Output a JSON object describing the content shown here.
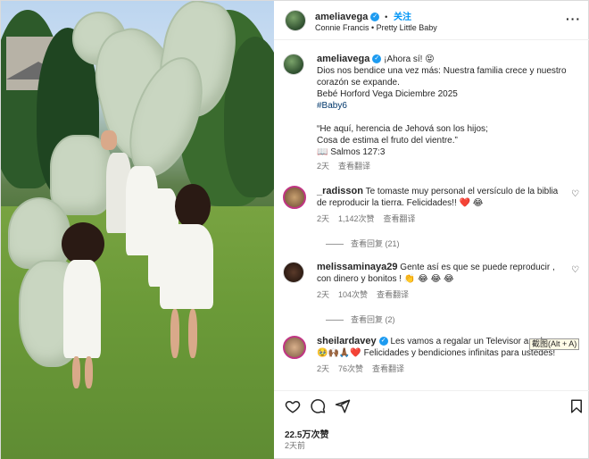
{
  "post": {
    "author": "ameliavega",
    "follow_label": "关注",
    "audio": "Connie Francis • Pretty Little Baby",
    "more_label": "···"
  },
  "caption": {
    "author": "ameliavega",
    "line1": "¡Ahora sí! 😝",
    "line2": "Dios nos bendice una vez más: Nuestra familia crece y nuestro corazón se expande.",
    "line3": "Bebé Horford Vega Diciembre 2025",
    "hashtag": "#Baby6",
    "quote1": "“He aquí, herencia de Jehová son los hijos;",
    "quote2": "Cosa de estima el fruto del vientre.”",
    "quote3": "📖 Salmos 127:3",
    "time": "2天",
    "translate": "查看翻译"
  },
  "comments": [
    {
      "user": "_radisson",
      "text": "Te tomaste muy personal el versículo de la biblia de reproducir la tierra. Felicidades!! ❤️ 😂",
      "time": "2天",
      "likes": "1,142次赞",
      "translate": "查看翻译",
      "replies": "查看回复 (21)"
    },
    {
      "user": "melissaminaya29",
      "text": "Gente así es que se puede reproducir , con dinero y bonitos ! 👏 😂 😂 😂",
      "time": "2天",
      "likes": "104次赞",
      "translate": "查看翻译",
      "replies": "查看回复 (2)"
    },
    {
      "user": "sheilardavey",
      "text": "Les vamos a regalar un Televisor a colo… 🥹🙌🏾🙏🏾❤️ Felicidades y bendiciones infinitas para ustedes!",
      "time": "2天",
      "likes": "76次赞",
      "translate": "查看翻译"
    }
  ],
  "tooltip": "截图(Alt + A)",
  "footer": {
    "likes": "22.5万次赞",
    "posted": "2天前"
  },
  "colors": {
    "link": "#00376b",
    "follow": "#0095f6",
    "verified": "#1d9bf0",
    "balloon": "#c9d6c1"
  },
  "icons": [
    "heart-icon",
    "comment-icon",
    "share-icon",
    "bookmark-icon",
    "verified-icon",
    "more-icon"
  ]
}
